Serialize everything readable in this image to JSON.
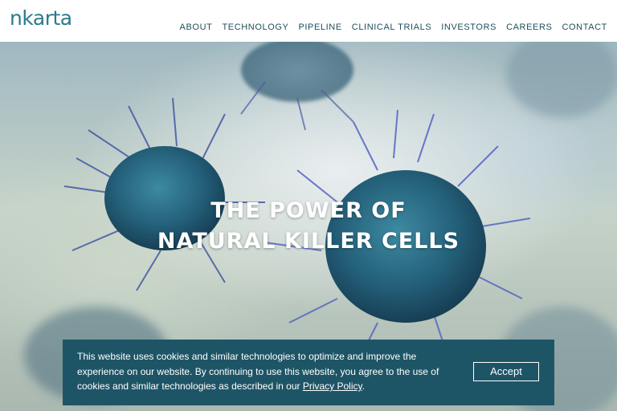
{
  "header": {
    "logo": "nkarta",
    "nav": [
      "ABOUT",
      "TECHNOLOGY",
      "PIPELINE",
      "CLINICAL TRIALS",
      "INVESTORS",
      "CAREERS",
      "CONTACT"
    ]
  },
  "hero": {
    "line1": "THE POWER OF",
    "line2": "NATURAL KILLER CELLS"
  },
  "cookie_banner": {
    "text_before_link": "This website uses cookies and similar technologies to optimize and improve the experience on our website. By continuing to use this website, you agree to the use of cookies and similar technologies as described in our ",
    "link_text": "Privacy Policy",
    "text_after_link": ".",
    "accept_label": "Accept"
  },
  "colors": {
    "brand": "#2b7a8c",
    "banner_bg": "#1e5566",
    "cell": "#2f6f86"
  }
}
